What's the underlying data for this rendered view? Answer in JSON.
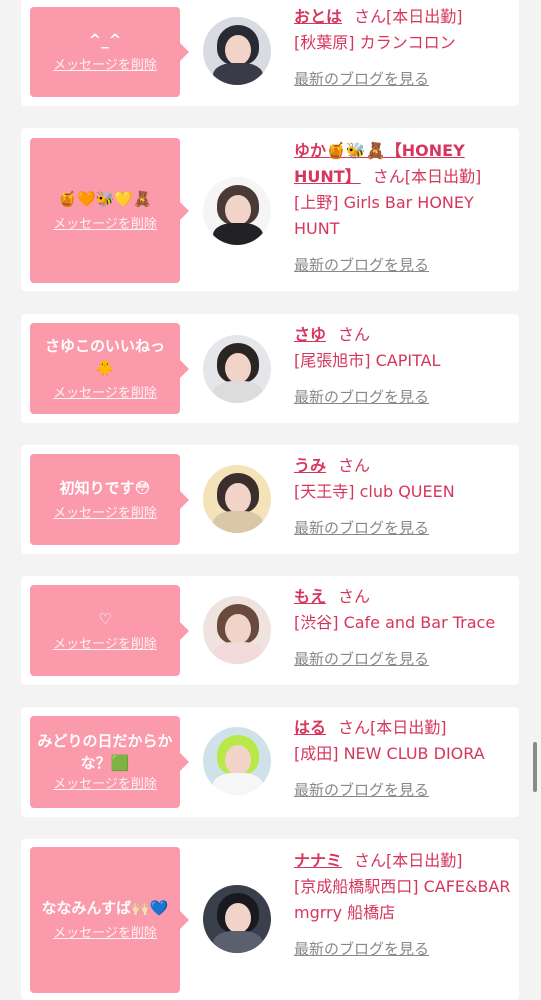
{
  "delete_label": "メッセージを削除",
  "blog_label": "最新のブログを見る",
  "san_label": "さん",
  "accent_color": "#fa9aab",
  "text_color": "#d6365c",
  "entries": [
    {
      "message": "^_^",
      "name": "おとは",
      "status": "[本日出勤]",
      "shop": "[秋葉原] カランコロン"
    },
    {
      "message": "🍯🧡🐝💛🧸",
      "name": "ゆか🍯🐝🧸【HONEY HUNT】",
      "status": "[本日出勤]",
      "shop": "[上野] Girls Bar HONEY HUNT"
    },
    {
      "message": "さゆこのいいねっ🐥",
      "name": "さゆ",
      "status": "",
      "shop": "[尾張旭市] CAPITAL"
    },
    {
      "message": "初知りです😳",
      "name": "うみ",
      "status": "",
      "shop": "[天王寺] club QUEEN"
    },
    {
      "message": "♡",
      "name": "もえ",
      "status": "",
      "shop": "[渋谷] Cafe and Bar Trace"
    },
    {
      "message": "みどりの日だからかな？🟩",
      "name": "はる",
      "status": "[本日出勤]",
      "shop": "[成田] NEW CLUB DIORA"
    },
    {
      "message": "ななみんすば🙌🏻💙",
      "name": "ナナミ",
      "status": "[本日出勤]",
      "shop": "[京成船橋駅西口] CAFE&BAR mgrry 船橋店"
    }
  ]
}
